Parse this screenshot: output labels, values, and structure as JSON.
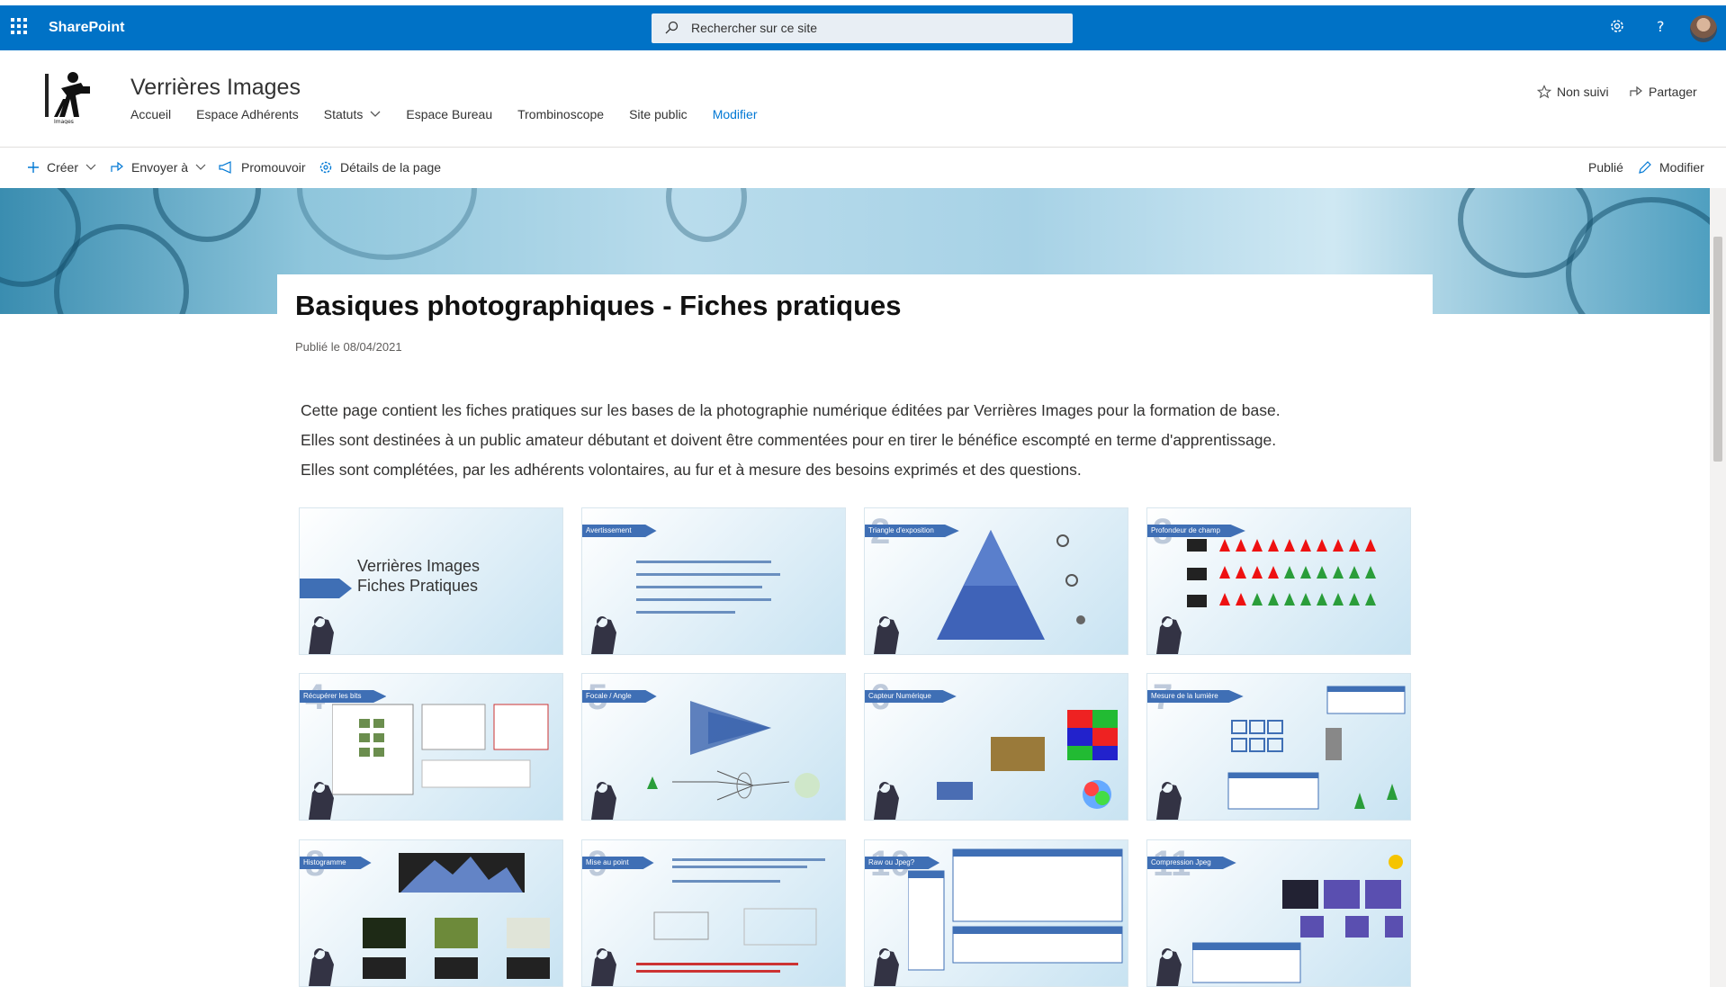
{
  "suitebar": {
    "brand": "SharePoint",
    "search_placeholder": "Rechercher sur ce site",
    "bg_color": "#0072c6"
  },
  "site": {
    "title": "Verrières Images",
    "nav": [
      "Accueil",
      "Espace Adhérents",
      "Statuts",
      "Espace Bureau",
      "Trombinoscope",
      "Site public",
      "Modifier"
    ],
    "follow_label": "Non suivi",
    "share_label": "Partager"
  },
  "commands": {
    "create": "Créer",
    "send": "Envoyer à",
    "promote": "Promouvoir",
    "details": "Détails de la page",
    "status": "Publié",
    "edit": "Modifier"
  },
  "page": {
    "title": "Basiques photographiques - Fiches pratiques",
    "published": "Publié le 08/04/2021",
    "description": [
      "Cette page contient les fiches pratiques sur les bases de la photographie numérique éditées par Verrières Images pour la formation de base.",
      "Elles sont destinées à un public amateur débutant et doivent être commentées pour en tirer le bénéfice escompté en terme d'apprentissage.",
      "Elles sont complétées, par les adhérents volontaires, au fur et à mesure des besoins exprimés et des questions."
    ]
  },
  "slides": [
    {
      "tag": "",
      "num": "",
      "heading": "Verrières Images",
      "heading2": "Fiches Pratiques"
    },
    {
      "tag": "Avertissement",
      "num": ""
    },
    {
      "tag": "Triangle d'exposition",
      "num": "2"
    },
    {
      "tag": "Profondeur de champ",
      "num": "3"
    },
    {
      "tag": "Récupérer les bits",
      "num": "4"
    },
    {
      "tag": "Focale / Angle",
      "num": "5"
    },
    {
      "tag": "Capteur Numérique",
      "num": "6"
    },
    {
      "tag": "Mesure de la lumière",
      "num": "7"
    },
    {
      "tag": "Histogramme",
      "num": "8"
    },
    {
      "tag": "Mise au point",
      "num": "9"
    },
    {
      "tag": "Raw ou Jpeg?",
      "num": "10"
    },
    {
      "tag": "Compression Jpeg",
      "num": "11"
    }
  ]
}
